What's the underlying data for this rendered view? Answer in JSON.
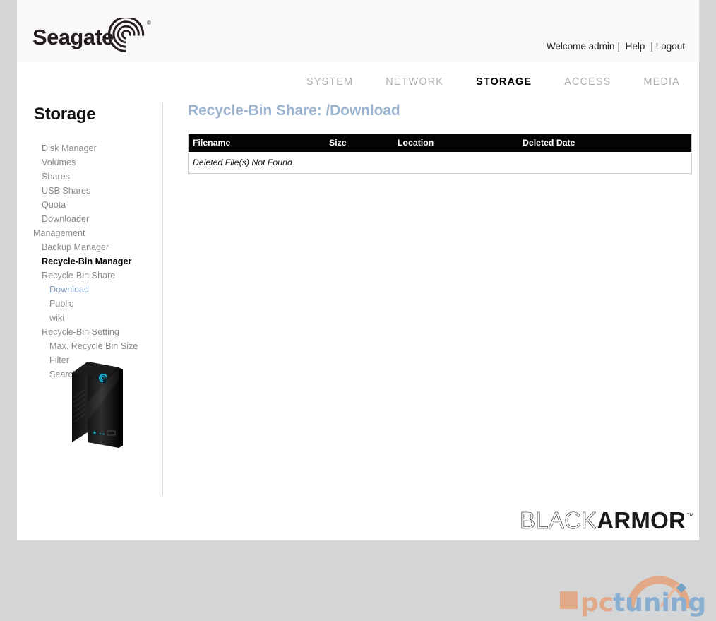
{
  "brand": {
    "logo_text": "Seagate",
    "logo_mark": "seagate-spiral-icon",
    "registered_mark": "®"
  },
  "account": {
    "welcome": "Welcome admin",
    "sep1": "|",
    "help": "Help",
    "sep2": "|",
    "logout": "Logout"
  },
  "nav": {
    "tabs": [
      {
        "label": "SYSTEM",
        "active": false
      },
      {
        "label": "NETWORK",
        "active": false
      },
      {
        "label": "STORAGE",
        "active": true
      },
      {
        "label": "ACCESS",
        "active": false
      },
      {
        "label": "MEDIA",
        "active": false
      }
    ]
  },
  "sidebar": {
    "title": "Storage",
    "items": [
      {
        "label": "Disk Manager",
        "level": 1,
        "state": "normal"
      },
      {
        "label": "Volumes",
        "level": 1,
        "state": "normal"
      },
      {
        "label": "Shares",
        "level": 1,
        "state": "normal"
      },
      {
        "label": "USB Shares",
        "level": 1,
        "state": "normal"
      },
      {
        "label": "Quota",
        "level": 1,
        "state": "normal"
      },
      {
        "label": "Downloader",
        "level": 1,
        "state": "normal"
      },
      {
        "label": "Management",
        "level": 0,
        "state": "normal"
      },
      {
        "label": "Backup Manager",
        "level": 1,
        "state": "normal"
      },
      {
        "label": "Recycle-Bin Manager",
        "level": 1,
        "state": "current"
      },
      {
        "label": "Recycle-Bin Share",
        "level": 1,
        "state": "normal"
      },
      {
        "label": "Download",
        "level": 2,
        "state": "link"
      },
      {
        "label": "Public",
        "level": 2,
        "state": "normal"
      },
      {
        "label": "wiki",
        "level": 2,
        "state": "normal"
      },
      {
        "label": "Recycle-Bin Setting",
        "level": 1,
        "state": "normal"
      },
      {
        "label": "Max. Recycle Bin Size",
        "level": 2,
        "state": "normal"
      },
      {
        "label": "Filter",
        "level": 2,
        "state": "normal"
      },
      {
        "label": "Search",
        "level": 2,
        "state": "normal"
      }
    ],
    "device_image_name": "blackarmor-nas-device-image"
  },
  "main": {
    "heading": "Recycle-Bin Share: /Download",
    "table": {
      "columns": [
        "Filename",
        "Size",
        "Location",
        "Deleted Date"
      ],
      "rows": [],
      "empty_message": "Deleted File(s) Not Found"
    }
  },
  "footer": {
    "logo_part1": "BLACK",
    "logo_part2": "ARMOR",
    "trademark": "™"
  },
  "watermark": {
    "text_pc": "pc",
    "text_tuning": "tuning",
    "color_orange": "#e8996b",
    "color_blue": "#6699cc"
  },
  "colors": {
    "page_background": "#d3d5d6",
    "content_background": "#ffffff",
    "heading_blue": "#9bb3cf",
    "link_blue": "#7d9cc2",
    "nav_inactive": "#b0b0b0",
    "sidebar_text": "#8a8a8a",
    "table_header_bg": "#040404"
  }
}
